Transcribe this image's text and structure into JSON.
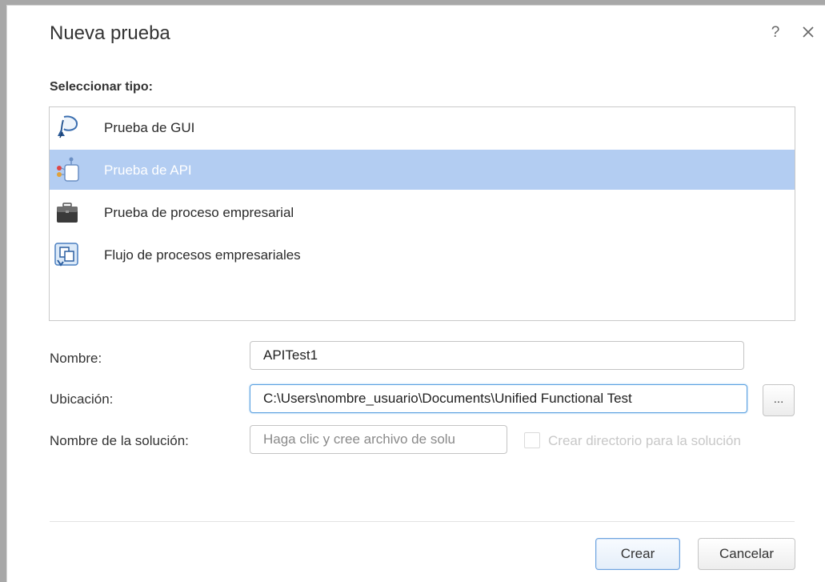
{
  "dialog": {
    "title": "Nueva prueba",
    "help_label": "?",
    "close_label": "close"
  },
  "type_section": {
    "label": "Seleccionar tipo:",
    "items": [
      {
        "label": "Prueba de GUI",
        "icon": "gui-test-icon",
        "selected": false
      },
      {
        "label": "Prueba de API",
        "icon": "api-test-icon",
        "selected": true
      },
      {
        "label": "Prueba de proceso empresarial",
        "icon": "briefcase-icon",
        "selected": false
      },
      {
        "label": "Flujo de procesos empresariales",
        "icon": "process-flow-icon",
        "selected": false
      }
    ]
  },
  "form": {
    "name_label": "Nombre:",
    "name_value": "APITest1",
    "location_label": "Ubicación:",
    "location_value": "C:\\Users\\nombre_usuario\\Documents\\Unified Functional Test",
    "browse_label": "...",
    "solution_label": "Nombre de la solución:",
    "solution_placeholder": "Haga clic y cree archivo de solu",
    "solution_dir_label": "Crear directorio para la solución"
  },
  "buttons": {
    "create": "Crear",
    "cancel": "Cancelar"
  },
  "colors": {
    "selection": "#b3cdf2",
    "focus_border": "#5aa0e0",
    "frame": "#a8a8a8"
  }
}
